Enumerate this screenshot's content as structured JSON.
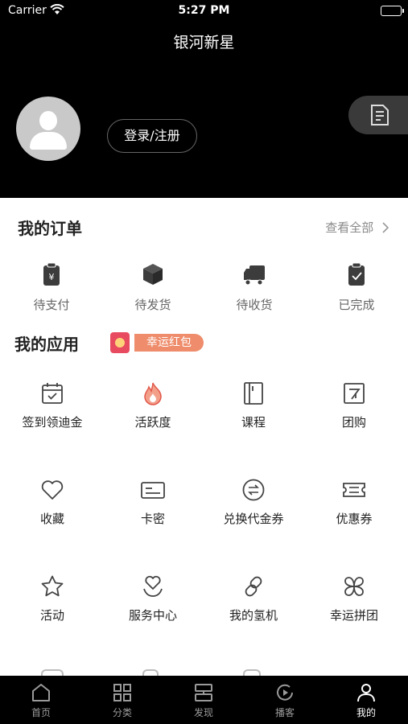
{
  "status": {
    "carrier": "Carrier",
    "time": "5:27 PM"
  },
  "header": {
    "title": "银河新星",
    "login_label": "登录/注册"
  },
  "orders": {
    "title": "我的订单",
    "see_all": "查看全部",
    "items": [
      {
        "label": "待支付",
        "icon": "payment-pending-icon"
      },
      {
        "label": "待发货",
        "icon": "package-icon"
      },
      {
        "label": "待收货",
        "icon": "truck-icon"
      },
      {
        "label": "已完成",
        "icon": "clipboard-check-icon"
      }
    ]
  },
  "apps": {
    "title": "我的应用",
    "lucky_badge": "幸运红包",
    "items": [
      {
        "label": "签到领迪金",
        "icon": "calendar-check-icon"
      },
      {
        "label": "活跃度",
        "icon": "flame-icon"
      },
      {
        "label": "课程",
        "icon": "book-icon"
      },
      {
        "label": "团购",
        "icon": "group-buy-icon"
      },
      {
        "label": "收藏",
        "icon": "heart-icon"
      },
      {
        "label": "卡密",
        "icon": "card-icon"
      },
      {
        "label": "兑换代金券",
        "icon": "exchange-icon"
      },
      {
        "label": "优惠券",
        "icon": "ticket-icon"
      },
      {
        "label": "活动",
        "icon": "star-icon"
      },
      {
        "label": "服务中心",
        "icon": "service-icon"
      },
      {
        "label": "我的氢机",
        "icon": "link-icon"
      },
      {
        "label": "幸运拼团",
        "icon": "clover-icon"
      }
    ]
  },
  "tabbar": {
    "active": "我的",
    "tabs": [
      {
        "label": "首页",
        "icon": "home-icon"
      },
      {
        "label": "分类",
        "icon": "grid-icon"
      },
      {
        "label": "发现",
        "icon": "discover-icon"
      },
      {
        "label": "播客",
        "icon": "play-icon"
      },
      {
        "label": "我的",
        "icon": "person-icon"
      }
    ]
  },
  "colors": {
    "header_bg": "#000000",
    "accent_badge": "#ee8c6b",
    "badge_icon": "#e84a5f"
  }
}
